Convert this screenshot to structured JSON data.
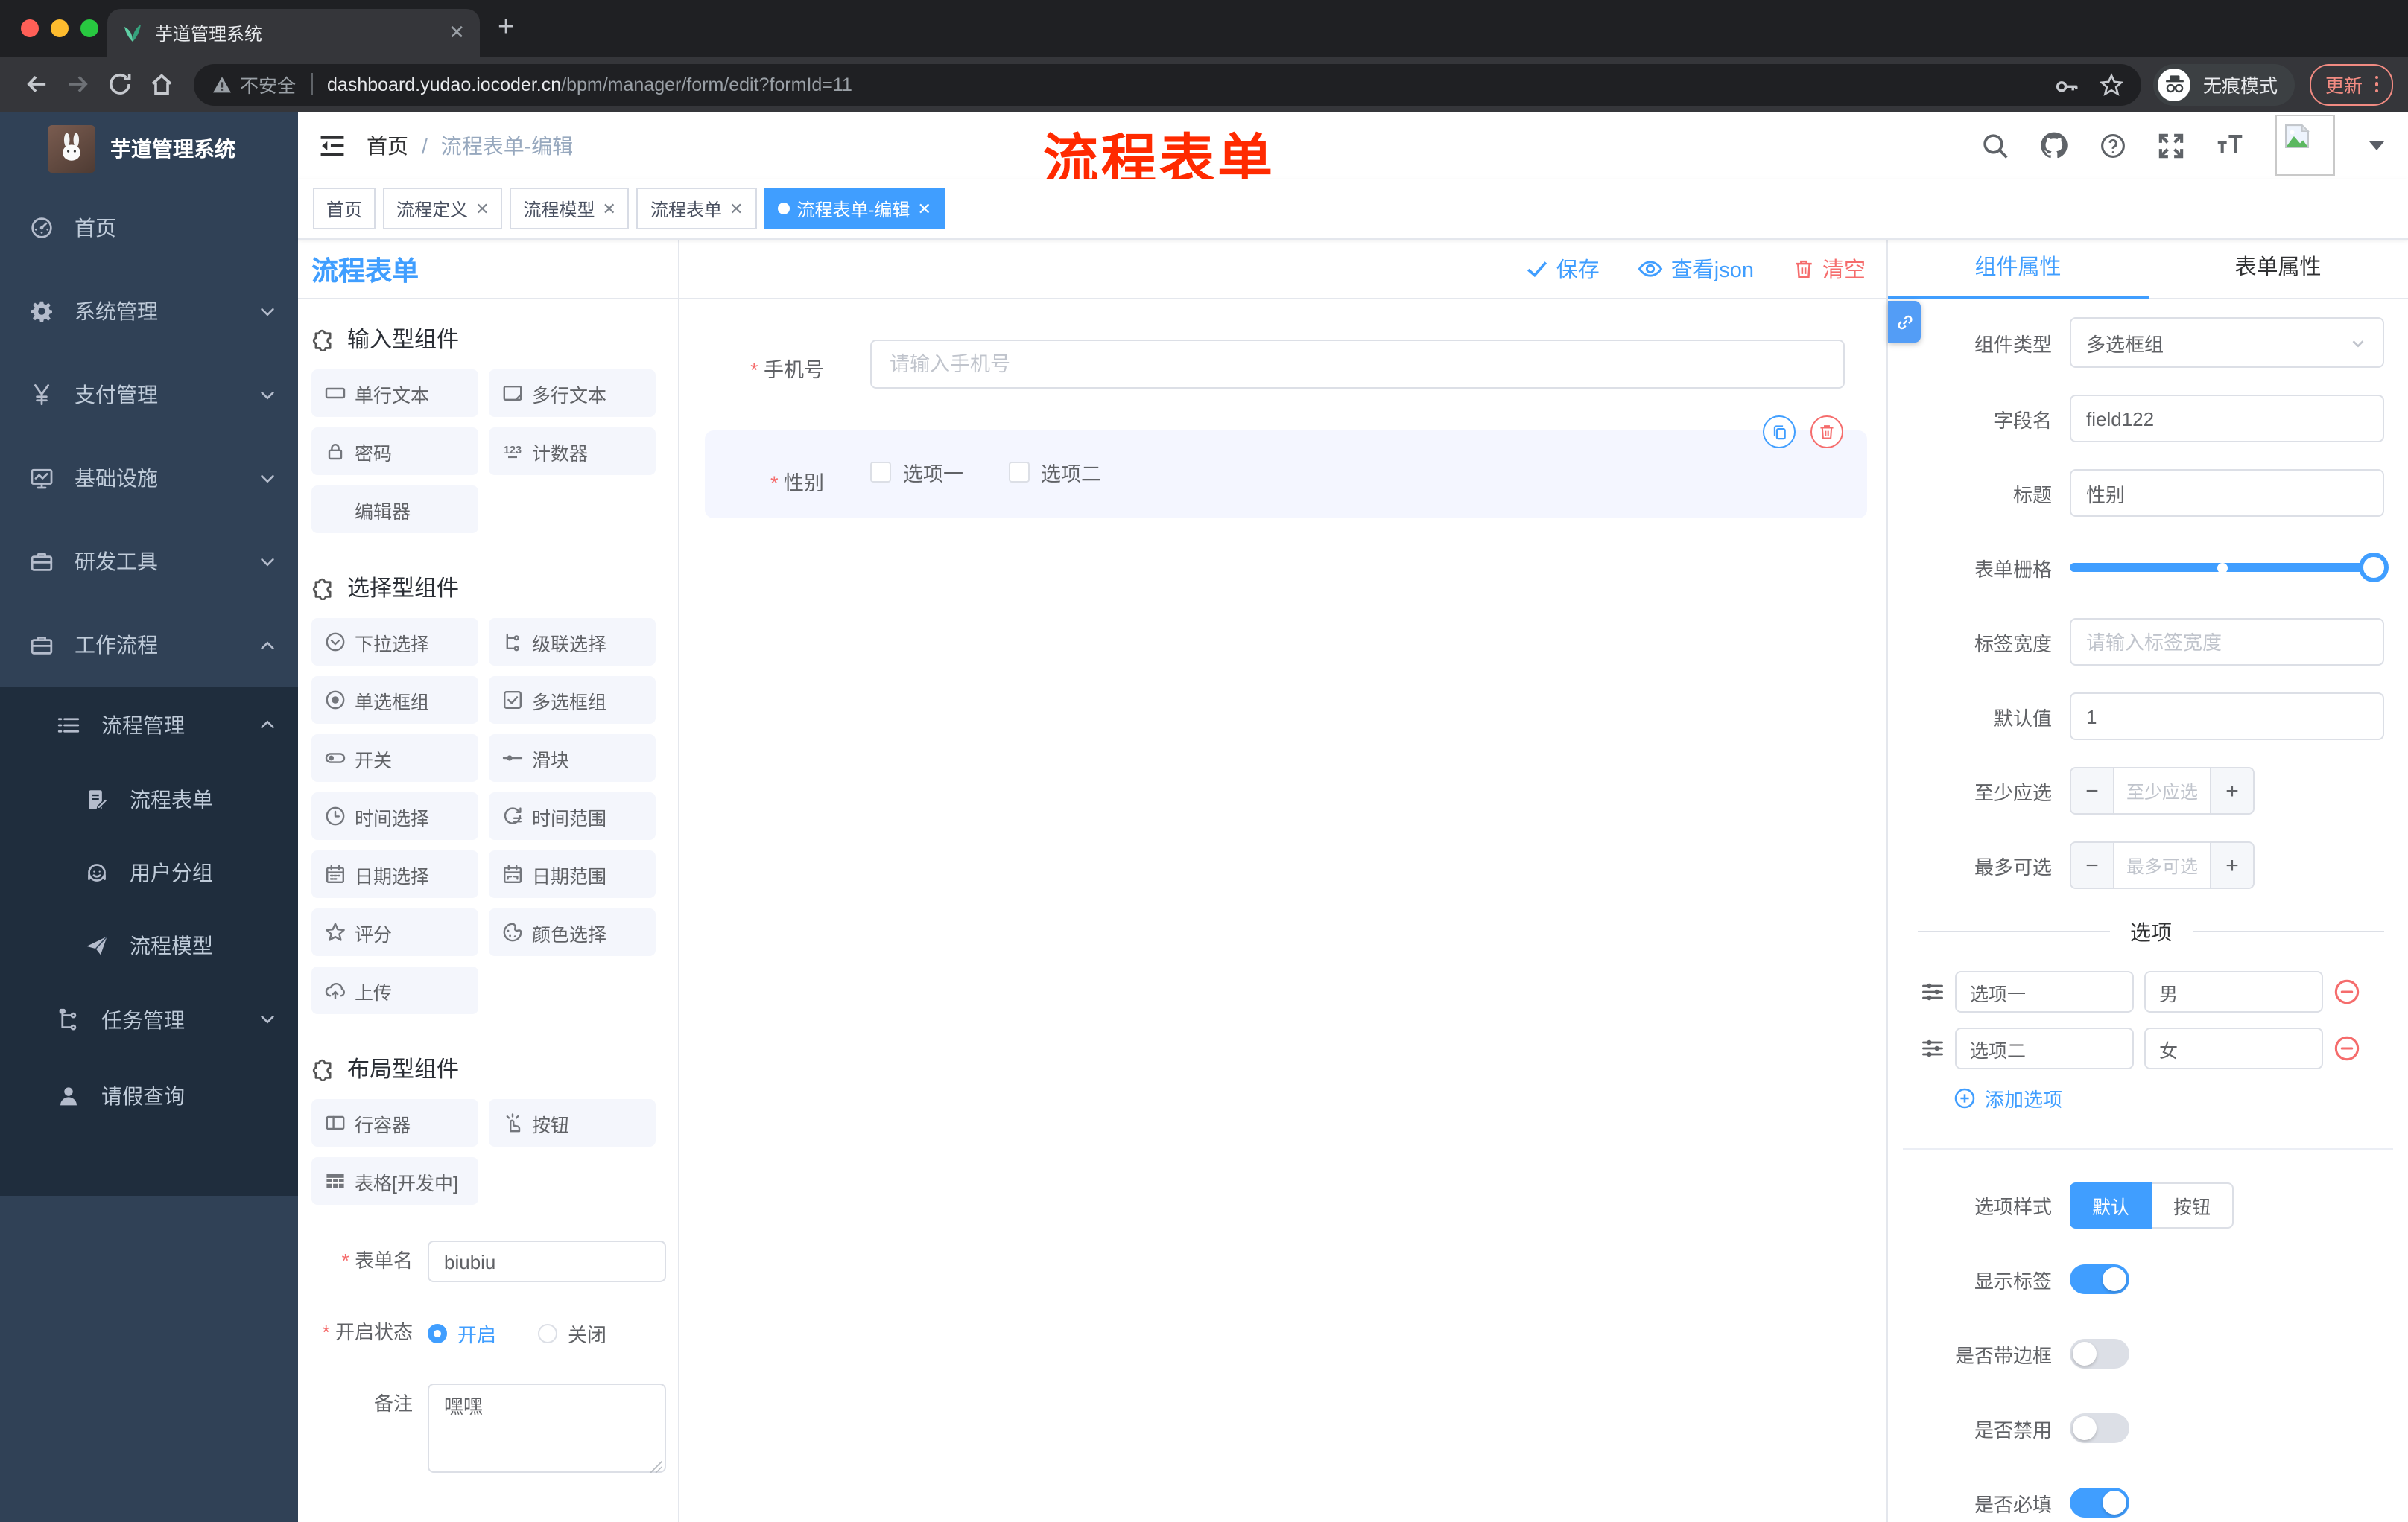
{
  "colors": {
    "primary": "#409eff",
    "danger": "#f56c6c",
    "sidebar": "#304156",
    "submenu": "#1f2d3d",
    "annotation": "#ff2a00"
  },
  "browser": {
    "tab_title": "芋道管理系统",
    "security_label": "不安全",
    "url_domain": "dashboard.yudao.iocoder.cn",
    "url_path": "/bpm/manager/form/edit?formId=11",
    "incognito_label": "无痕模式",
    "update_label": "更新"
  },
  "annotation": {
    "text": "流程表单"
  },
  "header": {
    "breadcrumb_home": "首页",
    "breadcrumb_current": "流程表单-编辑"
  },
  "tags": [
    {
      "label": "首页",
      "closable": false,
      "active": false
    },
    {
      "label": "流程定义",
      "closable": true,
      "active": false
    },
    {
      "label": "流程模型",
      "closable": true,
      "active": false
    },
    {
      "label": "流程表单",
      "closable": true,
      "active": false
    },
    {
      "label": "流程表单-编辑",
      "closable": true,
      "active": true
    }
  ],
  "sidebar": {
    "title": "芋道管理系统",
    "items": [
      {
        "label": "首页",
        "icon": "dashboard-icon",
        "chevron": ""
      },
      {
        "label": "系统管理",
        "icon": "gear-icon",
        "chevron": "down"
      },
      {
        "label": "支付管理",
        "icon": "yen-icon",
        "chevron": "down"
      },
      {
        "label": "基础设施",
        "icon": "monitor-icon",
        "chevron": "down"
      },
      {
        "label": "研发工具",
        "icon": "briefcase-icon",
        "chevron": "down"
      },
      {
        "label": "工作流程",
        "icon": "briefcase-icon",
        "chevron": "up"
      }
    ],
    "submenu": [
      {
        "label": "流程管理",
        "icon": "list-icon",
        "chevron": "up",
        "level": 1
      },
      {
        "label": "流程表单",
        "icon": "doc-edit-icon",
        "chevron": "",
        "level": 2
      },
      {
        "label": "用户分组",
        "icon": "face-icon",
        "chevron": "",
        "level": 2
      },
      {
        "label": "流程模型",
        "icon": "plane-icon",
        "chevron": "",
        "level": 2
      },
      {
        "label": "任务管理",
        "icon": "tree-icon",
        "chevron": "down",
        "level": 1
      },
      {
        "label": "请假查询",
        "icon": "person-icon",
        "chevron": "",
        "level": 1
      }
    ]
  },
  "palette": {
    "title": "流程表单",
    "sections": [
      {
        "title": "输入型组件",
        "items": [
          {
            "label": "单行文本",
            "icon": "input-icon"
          },
          {
            "label": "多行文本",
            "icon": "textarea-icon"
          },
          {
            "label": "密码",
            "icon": "lock-icon"
          },
          {
            "label": "计数器",
            "icon": "counter-icon"
          },
          {
            "label": "编辑器",
            "icon": "blank-icon"
          }
        ]
      },
      {
        "title": "选择型组件",
        "items": [
          {
            "label": "下拉选择",
            "icon": "select-icon"
          },
          {
            "label": "级联选择",
            "icon": "cascader-icon"
          },
          {
            "label": "单选框组",
            "icon": "radio-icon"
          },
          {
            "label": "多选框组",
            "icon": "checkbox-icon"
          },
          {
            "label": "开关",
            "icon": "switch-icon"
          },
          {
            "label": "滑块",
            "icon": "slider-icon"
          },
          {
            "label": "时间选择",
            "icon": "time-icon"
          },
          {
            "label": "时间范围",
            "icon": "time-range-icon"
          },
          {
            "label": "日期选择",
            "icon": "date-icon"
          },
          {
            "label": "日期范围",
            "icon": "date-range-icon"
          },
          {
            "label": "评分",
            "icon": "star-icon"
          },
          {
            "label": "颜色选择",
            "icon": "color-icon"
          },
          {
            "label": "上传",
            "icon": "upload-icon"
          }
        ]
      },
      {
        "title": "布局型组件",
        "items": [
          {
            "label": "行容器",
            "icon": "row-icon"
          },
          {
            "label": "按钮",
            "icon": "button-icon"
          },
          {
            "label": "表格[开发中]",
            "icon": "table-icon"
          }
        ]
      }
    ]
  },
  "form_meta": {
    "name_label": "表单名",
    "name_value": "biubiu",
    "status_label": "开启状态",
    "status_options": [
      "开启",
      "关闭"
    ],
    "status_selected": "开启",
    "remark_label": "备注",
    "remark_value": "嘿嘿"
  },
  "canvas": {
    "save_label": "保存",
    "view_json_label": "查看json",
    "clear_label": "清空",
    "phone": {
      "label": "手机号",
      "placeholder": "请输入手机号",
      "required": true
    },
    "gender": {
      "label": "性别",
      "required": true,
      "options": [
        "选项一",
        "选项二"
      ]
    }
  },
  "panel": {
    "tabs": [
      "组件属性",
      "表单属性"
    ],
    "active_tab": "组件属性",
    "fields": {
      "component_type_label": "组件类型",
      "component_type_value": "多选框组",
      "field_name_label": "字段名",
      "field_name_value": "field122",
      "title_label": "标题",
      "title_value": "性别",
      "grid_label": "表单栅格",
      "label_width_label": "标签宽度",
      "label_width_placeholder": "请输入标签宽度",
      "default_label": "默认值",
      "default_value": "1",
      "min_label": "至少应选",
      "min_placeholder": "至少应选",
      "max_label": "最多可选",
      "max_placeholder": "最多可选"
    },
    "options_divider": "选项",
    "options": [
      {
        "label": "选项一",
        "value": "男"
      },
      {
        "label": "选项二",
        "value": "女"
      }
    ],
    "add_option_label": "添加选项",
    "style_label": "选项样式",
    "style_options": [
      "默认",
      "按钮"
    ],
    "style_selected": "默认",
    "toggles": [
      {
        "label": "显示标签",
        "on": true
      },
      {
        "label": "是否带边框",
        "on": false
      },
      {
        "label": "是否禁用",
        "on": false
      },
      {
        "label": "是否必填",
        "on": true
      }
    ]
  }
}
